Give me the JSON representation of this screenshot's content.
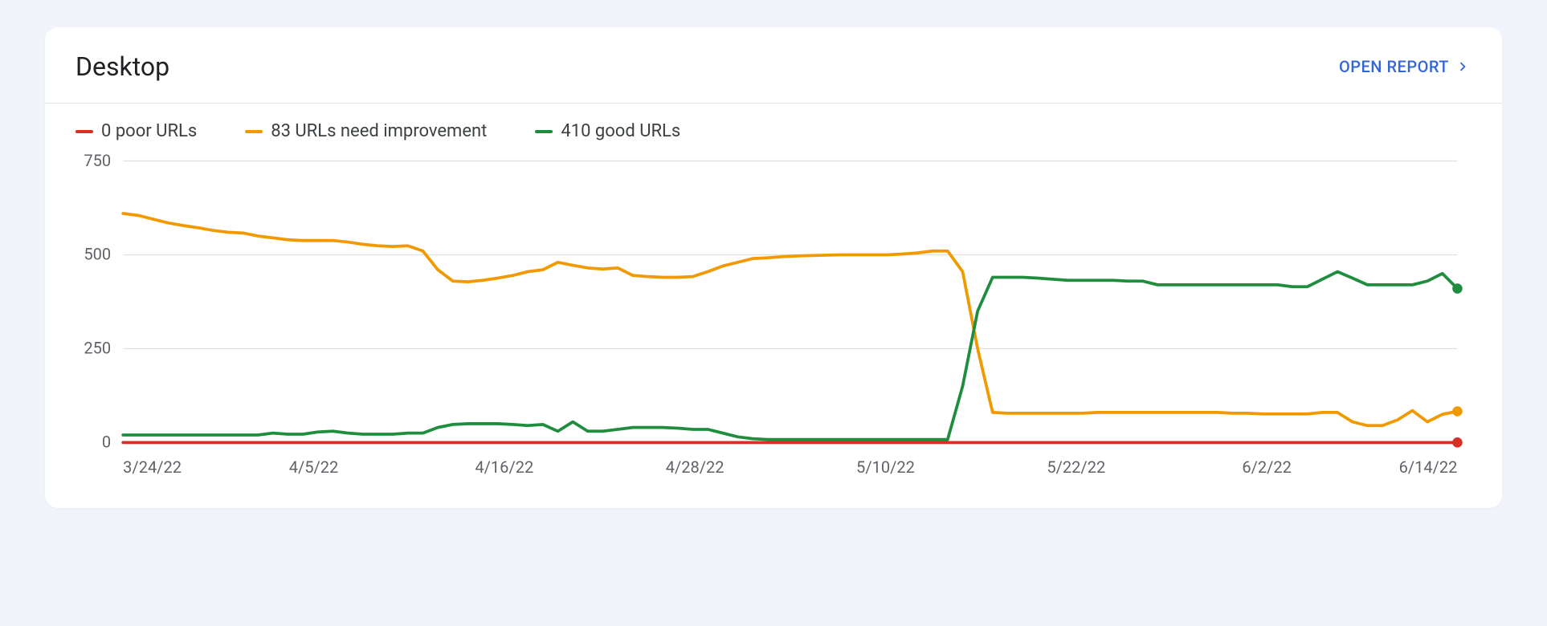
{
  "card": {
    "title": "Desktop",
    "open_report_label": "OPEN REPORT"
  },
  "legend": {
    "poor": {
      "label": "0 poor URLs",
      "color": "#d93025"
    },
    "improve": {
      "label": "83 URLs need improvement",
      "color": "#f29900"
    },
    "good": {
      "label": "410 good URLs",
      "color": "#1e8e3e"
    }
  },
  "chart_data": {
    "type": "line",
    "title": "Desktop",
    "xlabel": "",
    "ylabel": "",
    "ylim": [
      0,
      750
    ],
    "y_ticks": [
      0,
      250,
      500,
      750
    ],
    "x_ticks": [
      "3/24/22",
      "4/5/22",
      "4/16/22",
      "4/28/22",
      "5/10/22",
      "5/22/22",
      "6/2/22",
      "6/14/22"
    ],
    "x": [
      0,
      1,
      2,
      3,
      4,
      5,
      6,
      7,
      8,
      9,
      10,
      11,
      12,
      13,
      14,
      15,
      16,
      17,
      18,
      19,
      20,
      21,
      22,
      23,
      24,
      25,
      26,
      27,
      28,
      29,
      30,
      31,
      32,
      33,
      34,
      35,
      36,
      37,
      38,
      39,
      40,
      41,
      42,
      43,
      44,
      45,
      46,
      47,
      48,
      49,
      50,
      51,
      52,
      53,
      54,
      55,
      56,
      57,
      58,
      59,
      60,
      61,
      62,
      63,
      64,
      65,
      66,
      67,
      68,
      69,
      70,
      71,
      72,
      73,
      74,
      75,
      76,
      77,
      78,
      79,
      80,
      81,
      82,
      83,
      84,
      85,
      86,
      87,
      88,
      89
    ],
    "series": [
      {
        "name": "poor",
        "color": "#d93025",
        "values": [
          0,
          0,
          0,
          0,
          0,
          0,
          0,
          0,
          0,
          0,
          0,
          0,
          0,
          0,
          0,
          0,
          0,
          0,
          0,
          0,
          0,
          0,
          0,
          0,
          0,
          0,
          0,
          0,
          0,
          0,
          0,
          0,
          0,
          0,
          0,
          0,
          0,
          0,
          0,
          0,
          0,
          0,
          0,
          0,
          0,
          0,
          0,
          0,
          0,
          0,
          0,
          0,
          0,
          0,
          0,
          0,
          0,
          0,
          0,
          0,
          0,
          0,
          0,
          0,
          0,
          0,
          0,
          0,
          0,
          0,
          0,
          0,
          0,
          0,
          0,
          0,
          0,
          0,
          0,
          0,
          0,
          0,
          0,
          0,
          0,
          0,
          0,
          0,
          0,
          0
        ]
      },
      {
        "name": "need improvement",
        "color": "#f29900",
        "values": [
          610,
          605,
          595,
          585,
          578,
          572,
          565,
          560,
          558,
          550,
          545,
          540,
          538,
          538,
          538,
          534,
          528,
          524,
          522,
          524,
          510,
          460,
          430,
          428,
          432,
          438,
          445,
          455,
          460,
          480,
          472,
          465,
          462,
          465,
          445,
          442,
          440,
          440,
          442,
          455,
          470,
          480,
          490,
          492,
          495,
          497,
          498,
          499,
          500,
          500,
          500,
          500,
          502,
          505,
          510,
          510,
          455,
          250,
          80,
          78,
          78,
          78,
          78,
          78,
          78,
          80,
          80,
          80,
          80,
          80,
          80,
          80,
          80,
          80,
          78,
          78,
          76,
          76,
          76,
          76,
          80,
          80,
          55,
          45,
          45,
          60,
          85,
          55,
          75,
          83
        ]
      },
      {
        "name": "good",
        "color": "#1e8e3e",
        "values": [
          20,
          20,
          20,
          20,
          20,
          20,
          20,
          20,
          20,
          20,
          25,
          22,
          22,
          28,
          30,
          25,
          22,
          22,
          22,
          25,
          25,
          40,
          48,
          50,
          50,
          50,
          48,
          45,
          48,
          30,
          55,
          30,
          30,
          35,
          40,
          40,
          40,
          38,
          35,
          35,
          25,
          15,
          10,
          8,
          8,
          8,
          8,
          8,
          8,
          8,
          8,
          8,
          8,
          8,
          8,
          8,
          150,
          350,
          440,
          440,
          440,
          438,
          435,
          432,
          432,
          432,
          432,
          430,
          430,
          420,
          420,
          420,
          420,
          420,
          420,
          420,
          420,
          420,
          415,
          415,
          435,
          455,
          438,
          420,
          420,
          420,
          420,
          430,
          450,
          410
        ]
      }
    ],
    "legend": [
      "0 poor URLs",
      "83 URLs need improvement",
      "410 good URLs"
    ],
    "legend_position": "top"
  }
}
